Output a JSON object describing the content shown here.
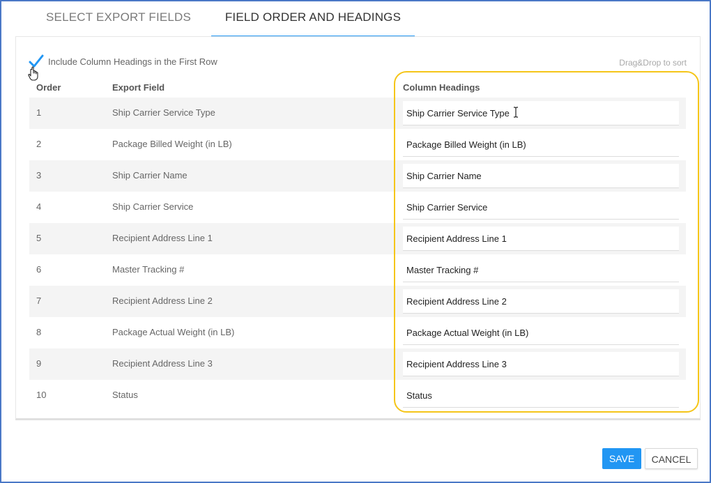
{
  "tabs": [
    {
      "label": "SELECT EXPORT FIELDS"
    },
    {
      "label": "FIELD ORDER AND HEADINGS"
    }
  ],
  "options": {
    "include_headings_label": "Include Column Headings in the First Row",
    "include_headings_checked": true,
    "drag_hint": "Drag&Drop to sort"
  },
  "table": {
    "headers": {
      "order": "Order",
      "export_field": "Export Field",
      "column_headings": "Column Headings"
    },
    "rows": [
      {
        "order": "1",
        "field": "Ship Carrier Service Type",
        "heading": "Ship Carrier Service Type"
      },
      {
        "order": "2",
        "field": "Package Billed Weight (in LB)",
        "heading": "Package Billed Weight (in LB)"
      },
      {
        "order": "3",
        "field": "Ship Carrier Name",
        "heading": "Ship Carrier Name"
      },
      {
        "order": "4",
        "field": "Ship Carrier Service",
        "heading": "Ship Carrier Service"
      },
      {
        "order": "5",
        "field": "Recipient Address Line 1",
        "heading": "Recipient Address Line 1"
      },
      {
        "order": "6",
        "field": "Master Tracking #",
        "heading": "Master Tracking #"
      },
      {
        "order": "7",
        "field": "Recipient Address Line 2",
        "heading": "Recipient Address Line 2"
      },
      {
        "order": "8",
        "field": "Package Actual Weight (in LB)",
        "heading": "Package Actual Weight (in LB)"
      },
      {
        "order": "9",
        "field": "Recipient Address Line 3",
        "heading": "Recipient Address Line 3"
      },
      {
        "order": "10",
        "field": "Status",
        "heading": "Status"
      }
    ]
  },
  "buttons": {
    "save": "SAVE",
    "cancel": "CANCEL"
  },
  "colors": {
    "accent": "#2196f3",
    "highlight": "#f5c518",
    "frame": "#4a78c6"
  },
  "icons": {
    "checkbox": "checkmark-icon",
    "cursor": "hand-pointer-icon",
    "text_cursor": "i-beam-cursor-icon"
  }
}
